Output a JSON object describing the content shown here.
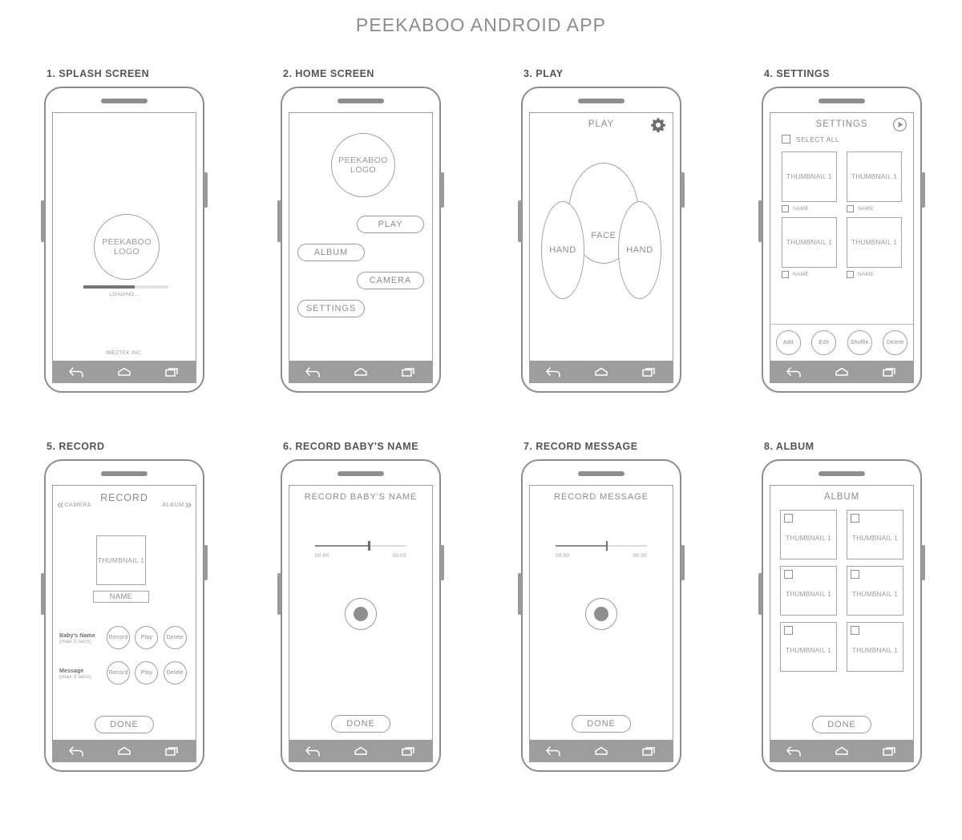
{
  "page": {
    "title": "PEEKABOO ANDROID APP"
  },
  "nav": {
    "back": "back-icon",
    "home": "home-icon",
    "recents": "recents-icon"
  },
  "screens": [
    {
      "caption": "1. SPLASH SCREEN",
      "logo": {
        "line1": "PEEKABOO",
        "line2": "LOGO"
      },
      "loading_label": "LOADING...",
      "loading_percent": 60,
      "footer": "IMEZTEK INC."
    },
    {
      "caption": "2. HOME SCREEN",
      "logo": {
        "line1": "PEEKABOO",
        "line2": "LOGO"
      },
      "buttons": [
        {
          "label": "PLAY",
          "align": "right"
        },
        {
          "label": "ALBUM",
          "align": "left"
        },
        {
          "label": "CAMERA",
          "align": "right"
        },
        {
          "label": "SETTINGS",
          "align": "left"
        }
      ]
    },
    {
      "caption": "3. PLAY",
      "title": "PLAY",
      "gear_icon": "gear-icon",
      "face_label": "FACE",
      "hand_left_label": "HAND",
      "hand_right_label": "HAND"
    },
    {
      "caption": "4. SETTINGS",
      "title": "SETTINGS",
      "play_icon": "play-circle-icon",
      "select_all": "SELECT ALL",
      "thumbnails": [
        {
          "label": "THUMBNAIL 1",
          "name": "NAME"
        },
        {
          "label": "THUMBNAIL 1",
          "name": "NAME"
        },
        {
          "label": "THUMBNAIL 1",
          "name": "NAME"
        },
        {
          "label": "THUMBNAIL 1",
          "name": "NAME"
        }
      ],
      "actions": [
        "Add",
        "Edit",
        "Shuffle",
        "Delete"
      ]
    },
    {
      "caption": "5. RECORD",
      "title": "RECORD",
      "left_nav": "CAMERA",
      "right_nav": "ALBUM",
      "thumbnail": "THUMBNAIL 1",
      "name_field": "NAME",
      "rows": [
        {
          "label": "Baby's Name",
          "sub": "(max 3 secs)",
          "buttons": [
            "Record",
            "Play",
            "Delete"
          ]
        },
        {
          "label": "Message",
          "sub": "(max 3 secs)",
          "buttons": [
            "Record",
            "Play",
            "Delete"
          ]
        }
      ],
      "done": "DONE"
    },
    {
      "caption": "6. RECORD BABY'S NAME",
      "title": "RECORD BABY'S NAME",
      "slider": {
        "start": "00:00",
        "end": "00:03",
        "position_percent": 58
      },
      "record_button": "record-button",
      "done": "DONE"
    },
    {
      "caption": "7. RECORD MESSAGE",
      "title": "RECORD MESSAGE",
      "slider": {
        "start": "00:00",
        "end": "00:30",
        "position_percent": 55
      },
      "record_button": "record-button",
      "done": "DONE"
    },
    {
      "caption": "8. ALBUM",
      "title": "ALBUM",
      "thumbnails": [
        "THUMBNAIL 1",
        "THUMBNAIL 1",
        "THUMBNAIL 1",
        "THUMBNAIL 1",
        "THUMBNAIL 1",
        "THUMBNAIL 1"
      ],
      "done": "DONE"
    }
  ],
  "colors": {
    "outline": "#8d8d8d",
    "text": "#8c8c8c",
    "navbar": "#9d9d9d",
    "accent_fill": "#777777"
  }
}
